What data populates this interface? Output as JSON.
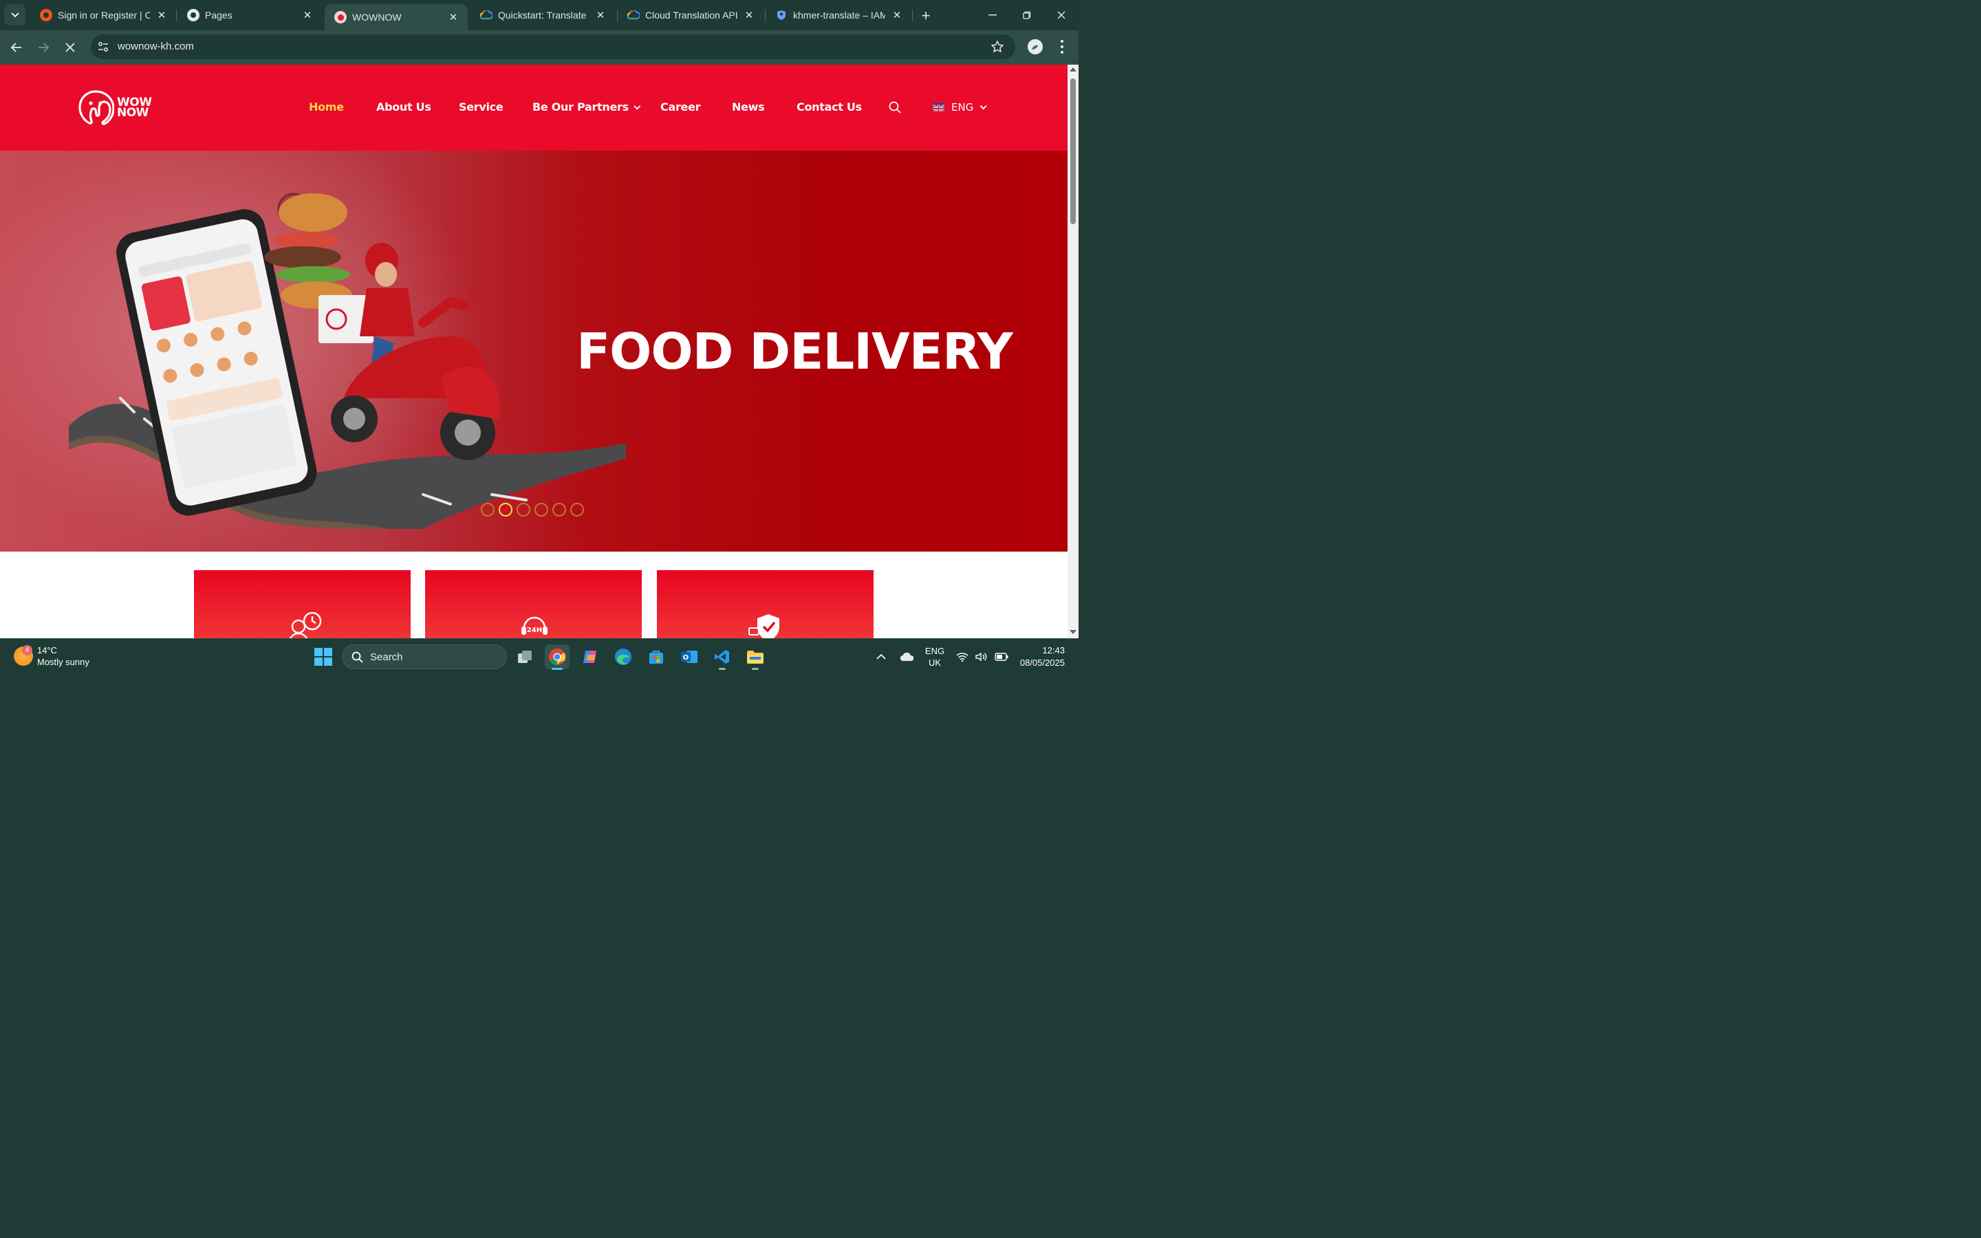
{
  "browser": {
    "tabs": [
      {
        "title": "Sign in or Register | Coc",
        "icon": "codecademy-icon",
        "active": false
      },
      {
        "title": "Pages",
        "icon": "github-icon",
        "active": false
      },
      {
        "title": "WOWNOW",
        "icon": "wownow-icon",
        "active": true
      },
      {
        "title": "Quickstart: Translate tex",
        "icon": "google-cloud-icon",
        "active": false
      },
      {
        "title": "Cloud Translation API |",
        "icon": "google-cloud-icon",
        "active": false
      },
      {
        "title": "khmer-translate – IAM &",
        "icon": "shield-icon",
        "active": false
      }
    ],
    "url": "wownow-kh.com"
  },
  "site": {
    "logo_text_top": "WOW",
    "logo_text_bottom": "NOW",
    "nav": [
      {
        "label": "Home",
        "active": true
      },
      {
        "label": "About Us",
        "active": false
      },
      {
        "label": "Service",
        "active": false
      },
      {
        "label": "Be Our Partners",
        "active": false,
        "dropdown": true
      },
      {
        "label": "Career",
        "active": false
      },
      {
        "label": "News",
        "active": false
      },
      {
        "label": "Contact Us",
        "active": false
      }
    ],
    "language": "ENG",
    "hero_title": "FOOD DELIVERY",
    "slider": {
      "count": 6,
      "active_index": 1
    },
    "cards": [
      {
        "icon": "delivery-person-clock-icon"
      },
      {
        "icon": "support-24h-icon"
      },
      {
        "icon": "shield-check-icon"
      }
    ],
    "colors": {
      "brand_red": "#ea0a2a",
      "active_nav": "#ffd84a"
    }
  },
  "taskbar": {
    "weather_temp": "14°C",
    "weather_desc": "Mostly sunny",
    "weather_badge": "4",
    "search_label": "Search",
    "lang_top": "ENG",
    "lang_bottom": "UK",
    "time": "12:43",
    "date": "08/05/2025"
  }
}
